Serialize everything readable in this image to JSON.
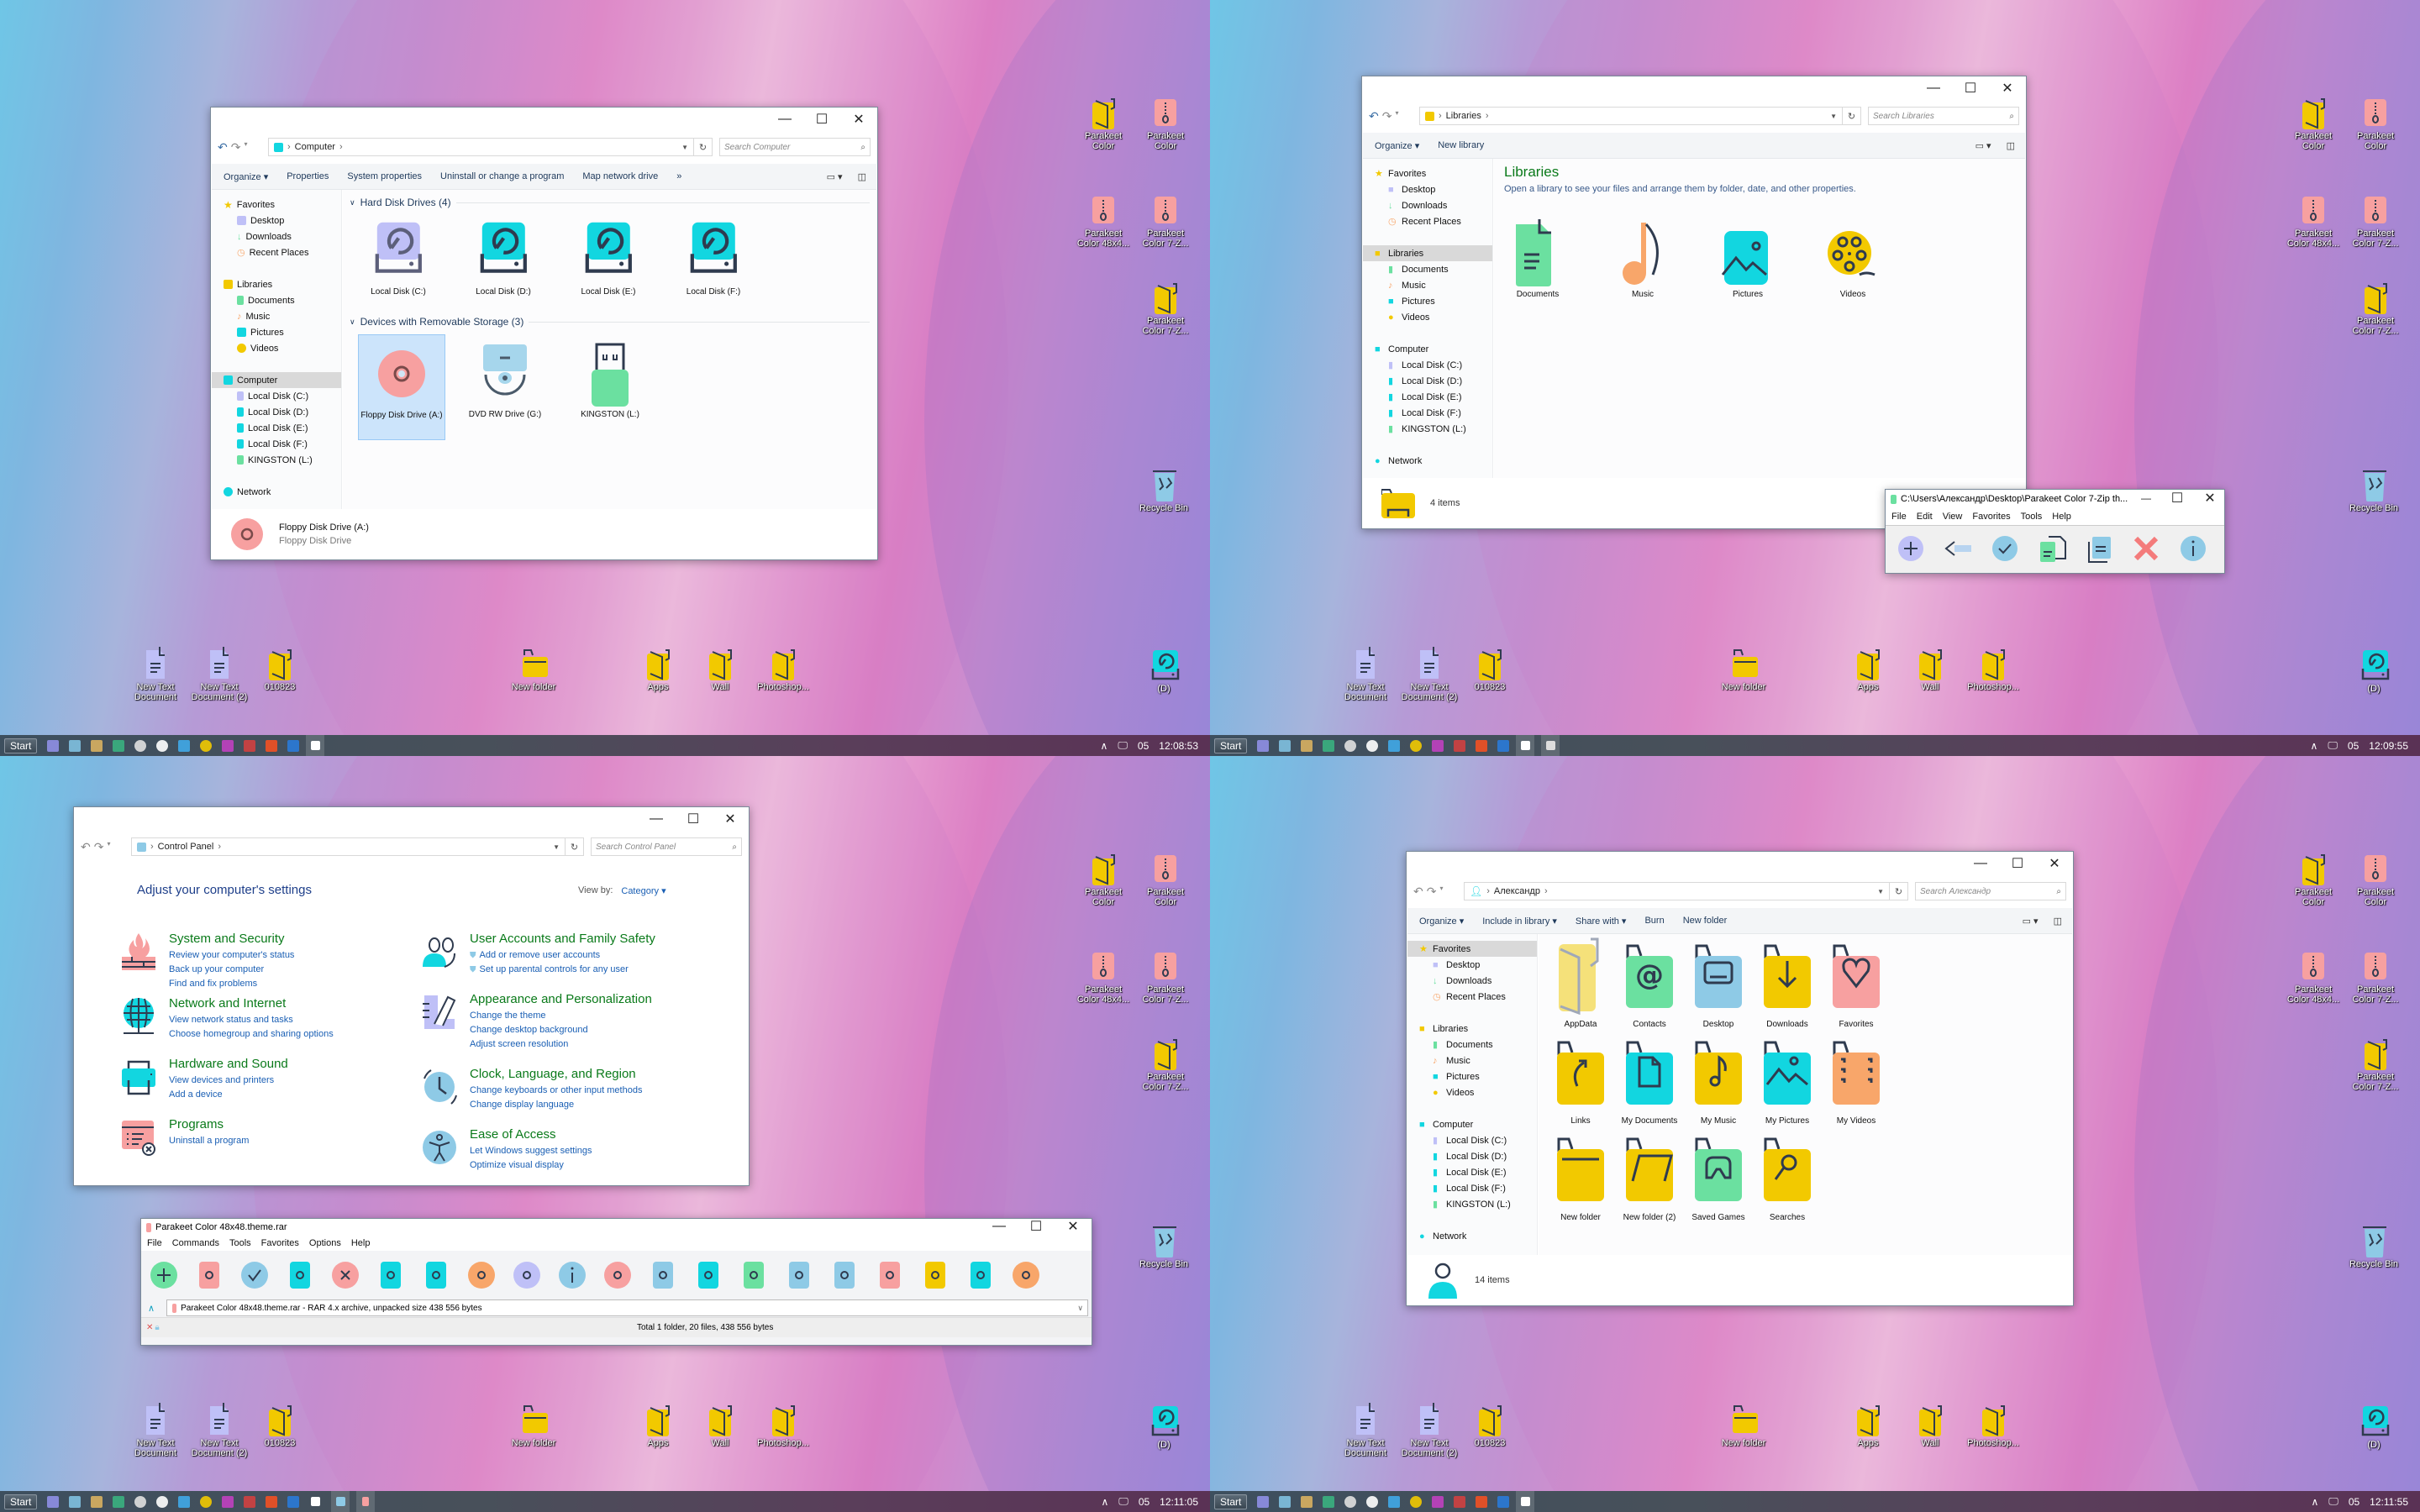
{
  "desktop": {
    "top_right_icons": [
      {
        "label": "Parakeet Color",
        "type": "folder"
      },
      {
        "label": "Parakeet Color",
        "type": "archive"
      },
      {
        "label": "Parakeet Color 48x4...",
        "type": "archive"
      },
      {
        "label": "Parakeet Color 7-Z...",
        "type": "archive"
      },
      {
        "label": "Parakeet Color 7-Z...",
        "type": "folder"
      }
    ],
    "recycle_bin": "Recycle Bin",
    "drive_d": "(D)",
    "bottom_icons": [
      {
        "label": "New Text Document",
        "type": "text"
      },
      {
        "label": "New Text Document (2)",
        "type": "text"
      },
      {
        "label": "010823",
        "type": "folder"
      },
      {
        "label": "New folder",
        "type": "folder-open"
      },
      {
        "label": "Apps",
        "type": "folder"
      },
      {
        "label": "Wall",
        "type": "folder"
      },
      {
        "label": "Photoshop...",
        "type": "folder"
      }
    ]
  },
  "taskbars": [
    {
      "start": "Start",
      "date": "05",
      "time": "12:08:53"
    },
    {
      "start": "Start",
      "date": "05",
      "time": "12:09:55"
    },
    {
      "start": "Start",
      "date": "05",
      "time": "12:11:05"
    },
    {
      "start": "Start",
      "date": "05",
      "time": "12:11:55"
    }
  ],
  "taskbar_icons": [
    "task-manager",
    "transfer",
    "pc-manager",
    "refresh-app",
    "globe",
    "media-player",
    "telegram",
    "video-player",
    "apps-grid",
    "pinterest",
    "windows-store",
    "browser"
  ],
  "explorer_computer": {
    "breadcrumb": [
      "Computer"
    ],
    "search_placeholder": "Search Computer",
    "commands": [
      "Organize ▾",
      "Properties",
      "System properties",
      "Uninstall or change a program",
      "Map network drive",
      "»"
    ],
    "nav": {
      "favorites": "Favorites",
      "favorites_items": [
        "Desktop",
        "Downloads",
        "Recent Places"
      ],
      "libraries": "Libraries",
      "libraries_items": [
        "Documents",
        "Music",
        "Pictures",
        "Videos"
      ],
      "computer": "Computer",
      "computer_items": [
        "Local Disk (C:)",
        "Local Disk (D:)",
        "Local Disk (E:)",
        "Local Disk (F:)",
        "KINGSTON (L:)"
      ],
      "network": "Network"
    },
    "group_hdd": "Hard Disk Drives (4)",
    "hdd": [
      "Local Disk (C:)",
      "Local Disk (D:)",
      "Local Disk (E:)",
      "Local Disk (F:)"
    ],
    "group_removable": "Devices with Removable Storage (3)",
    "removable": [
      "Floppy Disk Drive (A:)",
      "DVD RW Drive (G:)",
      "KINGSTON (L:)"
    ],
    "details_title": "Floppy Disk Drive (A:)",
    "details_sub": "Floppy Disk Drive"
  },
  "explorer_libraries": {
    "breadcrumb": [
      "Libraries"
    ],
    "search_placeholder": "Search Libraries",
    "commands": [
      "Organize ▾",
      "New library"
    ],
    "heading": "Libraries",
    "subheading": "Open a library to see your files and arrange them by folder, date, and other properties.",
    "items": [
      "Documents",
      "Music",
      "Pictures",
      "Videos"
    ],
    "status": "4 items"
  },
  "sevenzip": {
    "title": "C:\\Users\\Александр\\Desktop\\Parakeet Color 7-Zip th...",
    "menu": [
      "File",
      "Edit",
      "View",
      "Favorites",
      "Tools",
      "Help"
    ],
    "tools": [
      "add",
      "extract",
      "test",
      "copy",
      "move",
      "delete",
      "info"
    ]
  },
  "control_panel": {
    "breadcrumb": [
      "Control Panel"
    ],
    "search_placeholder": "Search Control Panel",
    "heading": "Adjust your computer's settings",
    "view_by_label": "View by:",
    "view_by_value": "Category ▾",
    "left": [
      {
        "title": "System and Security",
        "links": [
          "Review your computer's status",
          "Back up your computer",
          "Find and fix problems"
        ],
        "icon": "firewall"
      },
      {
        "title": "Network and Internet",
        "links": [
          "View network status and tasks",
          "Choose homegroup and sharing options"
        ],
        "icon": "globe"
      },
      {
        "title": "Hardware and Sound",
        "links": [
          "View devices and printers",
          "Add a device"
        ],
        "icon": "printer"
      },
      {
        "title": "Programs",
        "links": [
          "Uninstall a program"
        ],
        "icon": "programs"
      }
    ],
    "right": [
      {
        "title": "User Accounts and Family Safety",
        "links": [
          "Add or remove user accounts",
          "Set up parental controls for any user"
        ],
        "icon": "users"
      },
      {
        "title": "Appearance and Personalization",
        "links": [
          "Change the theme",
          "Change desktop background",
          "Adjust screen resolution"
        ],
        "icon": "appearance"
      },
      {
        "title": "Clock, Language, and Region",
        "links": [
          "Change keyboards or other input methods",
          "Change display language"
        ],
        "icon": "clock"
      },
      {
        "title": "Ease of Access",
        "links": [
          "Let Windows suggest settings",
          "Optimize visual display"
        ],
        "icon": "accessibility"
      }
    ]
  },
  "winrar": {
    "title": "Parakeet Color 48x48.theme.rar",
    "menu": [
      "File",
      "Commands",
      "Tools",
      "Favorites",
      "Options",
      "Help"
    ],
    "tools": [
      "add",
      "extract-to",
      "test",
      "view",
      "delete",
      "find",
      "wizard",
      "info-user",
      "repair",
      "info",
      "power",
      "settings",
      "back",
      "virus-scan",
      "comment",
      "protect",
      "lock",
      "sfx",
      "edit",
      "benchmark"
    ],
    "path": "Parakeet Color 48x48.theme.rar - RAR 4.x archive, unpacked size 438 556 bytes",
    "status": "Total 1 folder, 20 files, 438 556 bytes"
  },
  "explorer_user": {
    "breadcrumb": [
      "Александр"
    ],
    "search_placeholder": "Search Александр",
    "commands": [
      "Organize ▾",
      "Include in library ▾",
      "Share with ▾",
      "Burn",
      "New folder"
    ],
    "items": [
      {
        "label": "AppData",
        "color": "#f5e17a",
        "glyph": "open"
      },
      {
        "label": "Contacts",
        "color": "#6be0a0",
        "glyph": "@"
      },
      {
        "label": "Desktop",
        "color": "#8ecae6",
        "glyph": "desktop"
      },
      {
        "label": "Downloads",
        "color": "#f2c900",
        "glyph": "↓"
      },
      {
        "label": "Favorites",
        "color": "#f7a0a0",
        "glyph": "♡"
      },
      {
        "label": "Links",
        "color": "#f2c900",
        "glyph": "↱"
      },
      {
        "label": "My Documents",
        "color": "#12d6e0",
        "glyph": "doc"
      },
      {
        "label": "My Music",
        "color": "#f2c900",
        "glyph": "♪"
      },
      {
        "label": "My Pictures",
        "color": "#12d6e0",
        "glyph": "pic"
      },
      {
        "label": "My Videos",
        "color": "#f8a66a",
        "glyph": "film"
      },
      {
        "label": "New folder",
        "color": "#f2c900",
        "glyph": "line"
      },
      {
        "label": "New folder (2)",
        "color": "#f2c900",
        "glyph": "open2"
      },
      {
        "label": "Saved Games",
        "color": "#6be0a0",
        "glyph": "pad"
      },
      {
        "label": "Searches",
        "color": "#f2c900",
        "glyph": "search"
      }
    ],
    "status": "14 items"
  },
  "colors": {
    "teal": "#12d6e0",
    "lavender": "#bfc0f7",
    "green": "#6be0a0",
    "yellow": "#f2c900",
    "salmon": "#f7a0a0",
    "skyblue": "#8ecae6",
    "orange": "#f8a66a",
    "ink": "#2f3b4f",
    "link_blue": "#1a5fb4",
    "cp_green": "#0a7a1a"
  }
}
